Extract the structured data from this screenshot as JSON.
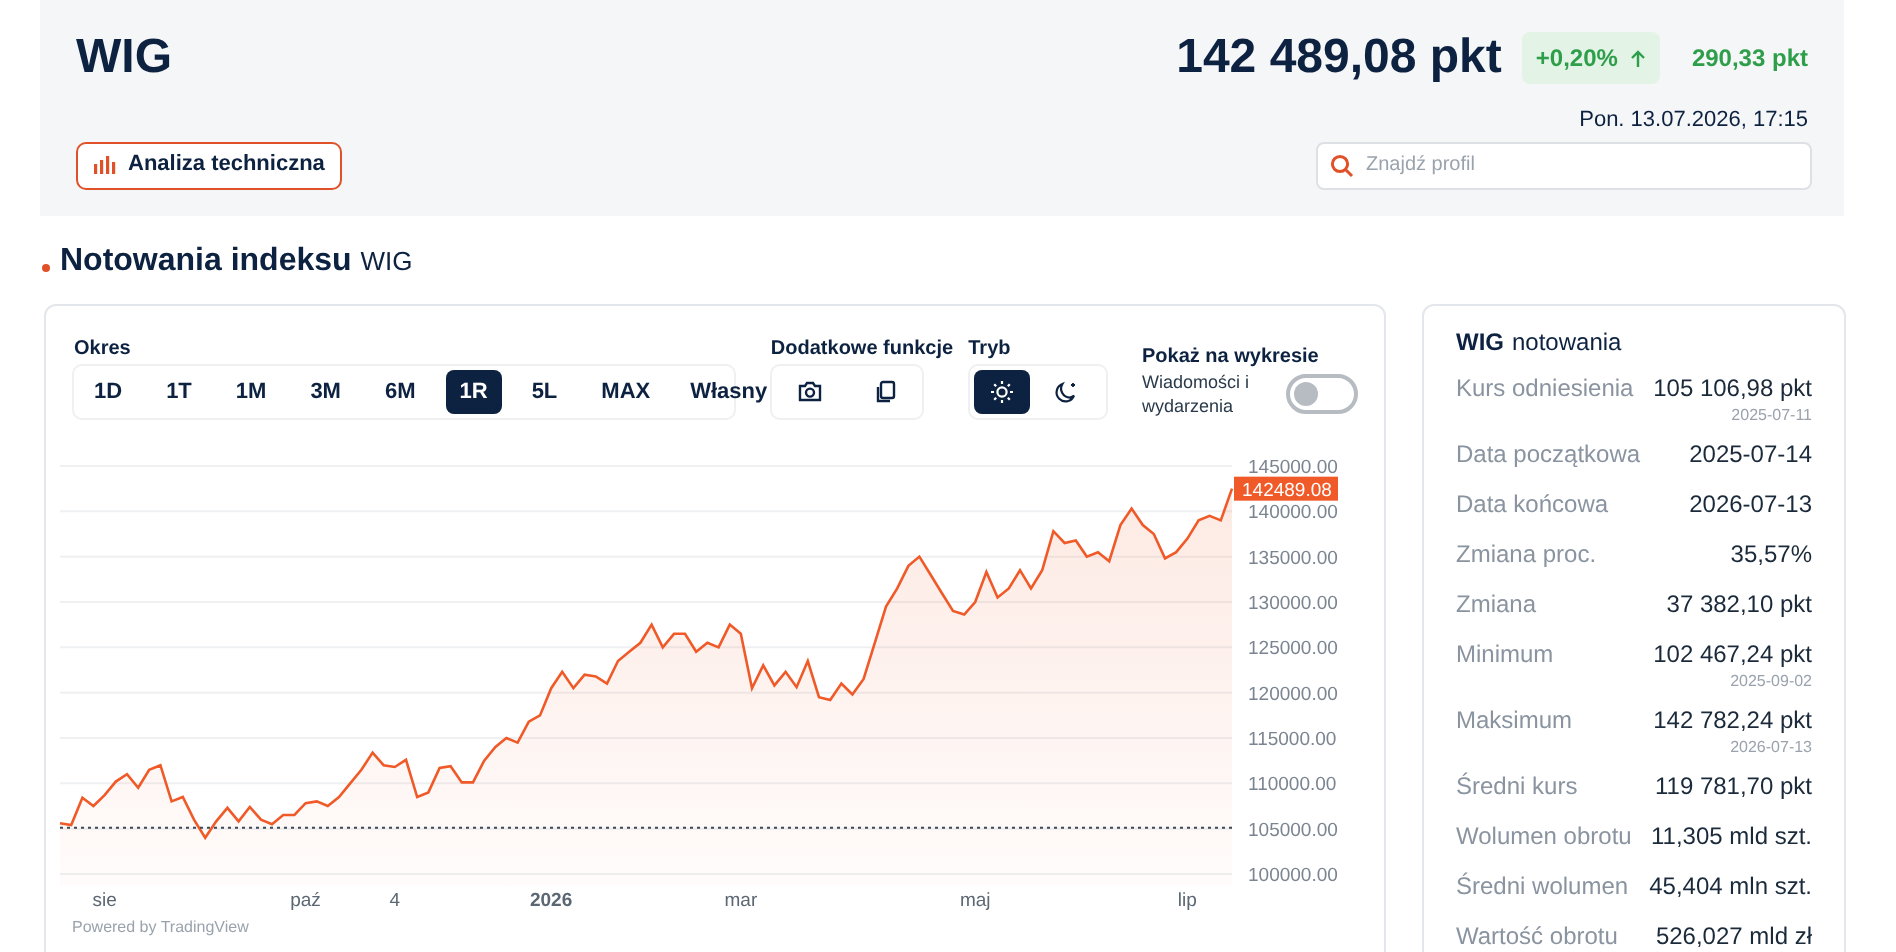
{
  "header": {
    "title": "WIG",
    "price": "142 489,08 pkt",
    "change_pct": "+0,20%",
    "change_abs": "290,33 pkt",
    "datetime": "Pon. 13.07.2026, 17:15",
    "tech_button": "Analiza techniczna",
    "search": {
      "placeholder": "Znajdź profil"
    }
  },
  "section": {
    "title": "Notowania indeksu",
    "suffix": "WIG"
  },
  "chart_panel": {
    "period_label": "Okres",
    "periods": [
      {
        "label": "1D",
        "selected": false
      },
      {
        "label": "1T",
        "selected": false
      },
      {
        "label": "1M",
        "selected": false
      },
      {
        "label": "3M",
        "selected": false
      },
      {
        "label": "6M",
        "selected": false
      },
      {
        "label": "1R",
        "selected": true
      },
      {
        "label": "5L",
        "selected": false
      },
      {
        "label": "MAX",
        "selected": false
      },
      {
        "label": "Własny",
        "selected": false
      }
    ],
    "extra_label": "Dodatkowe funkcje",
    "tools": [
      {
        "kind": "camera"
      },
      {
        "kind": "copy"
      }
    ],
    "mode_label": "Tryb",
    "modes": [
      {
        "kind": "light",
        "selected": true
      },
      {
        "kind": "dark",
        "selected": false
      }
    ],
    "show_label": "Pokaż na wykresie",
    "news_toggle": {
      "label": "Wiadomości i wydarzenia",
      "on": false
    },
    "chart_data": {
      "type": "area",
      "categories": [
        null,
        null,
        null,
        null,
        "sie",
        null,
        null,
        null,
        null,
        null,
        null,
        null,
        null,
        null,
        null,
        null,
        null,
        null,
        null,
        null,
        null,
        null,
        "paź",
        null,
        null,
        null,
        null,
        null,
        null,
        null,
        "4",
        null,
        null,
        null,
        null,
        null,
        null,
        null,
        null,
        null,
        null,
        null,
        null,
        null,
        "2026",
        null,
        null,
        null,
        null,
        null,
        null,
        null,
        null,
        null,
        null,
        null,
        null,
        null,
        null,
        null,
        null,
        "mar",
        null,
        null,
        null,
        null,
        null,
        null,
        null,
        null,
        null,
        null,
        null,
        null,
        null,
        null,
        null,
        null,
        null,
        null,
        null,
        null,
        "maj",
        null,
        null,
        null,
        null,
        null,
        null,
        null,
        null,
        null,
        null,
        null,
        null,
        null,
        null,
        null,
        null,
        null,
        null,
        "lip",
        null,
        null,
        null,
        null
      ],
      "series": [
        {
          "color": "#f05a28",
          "values": [
            105600,
            105400,
            108400,
            107500,
            108700,
            110200,
            111000,
            109500,
            111500,
            112000,
            108000,
            108500,
            106000,
            104000,
            105800,
            107300,
            105800,
            107400,
            106000,
            105500,
            106500,
            106500,
            107800,
            108000,
            107500,
            108500,
            110000,
            111500,
            113400,
            112000,
            111800,
            112600,
            108500,
            109000,
            111700,
            111900,
            110100,
            110100,
            112500,
            114000,
            115000,
            114500,
            116800,
            117500,
            120500,
            122300,
            120500,
            122000,
            121800,
            121000,
            123500,
            124500,
            125500,
            127500,
            125000,
            126500,
            126500,
            124500,
            125500,
            125000,
            127500,
            126500,
            120500,
            123000,
            120800,
            122300,
            120600,
            123500,
            119500,
            119200,
            121000,
            119800,
            121500,
            125500,
            129500,
            131500,
            134000,
            135000,
            133000,
            131000,
            129000,
            128600,
            130000,
            133300,
            130500,
            131500,
            133500,
            131500,
            133500,
            137800,
            136500,
            136800,
            135000,
            135500,
            134500,
            138500,
            140300,
            138500,
            137500,
            134800,
            135500,
            137000,
            139000,
            139500,
            139000,
            142500
          ]
        }
      ],
      "grid": true,
      "ylim": [
        100000,
        145000
      ],
      "yticks": [
        {
          "value": 100000,
          "label": "100000.00"
        },
        {
          "value": 105000,
          "label": "105000.00"
        },
        {
          "value": 110000,
          "label": "110000.00"
        },
        {
          "value": 115000,
          "label": "115000.00"
        },
        {
          "value": 120000,
          "label": "120000.00"
        },
        {
          "value": 125000,
          "label": "125000.00"
        },
        {
          "value": 130000,
          "label": "130000.00"
        },
        {
          "value": 135000,
          "label": "135000.00"
        },
        {
          "value": 140000,
          "label": "140000.00"
        },
        {
          "value": 145000,
          "label": "145000.00"
        }
      ],
      "ref_lines": [
        {
          "axis": "y",
          "value": 105107
        }
      ],
      "annotations": [
        "142489.08"
      ]
    },
    "footer": "Powered by TradingView"
  },
  "stats": {
    "title_bold": "WIG",
    "title_rest": "notowania",
    "rows": [
      {
        "label": "Kurs odniesienia",
        "value": "105 106,98 pkt",
        "date": "2025-07-11"
      },
      {
        "label": "Data początkowa",
        "value": "2025-07-14"
      },
      {
        "label": "Data końcowa",
        "value": "2026-07-13"
      },
      {
        "label": "Zmiana proc.",
        "value": "35,57%"
      },
      {
        "label": "Zmiana",
        "value": "37 382,10 pkt"
      },
      {
        "label": "Minimum",
        "value": "102 467,24 pkt",
        "date": "2025-09-02"
      },
      {
        "label": "Maksimum",
        "value": "142 782,24 pkt",
        "date": "2026-07-13"
      },
      {
        "label": "Średni kurs",
        "value": "119 781,70 pkt"
      },
      {
        "label": "Wolumen obrotu",
        "value": "11,305 mld szt."
      },
      {
        "label": "Średni wolumen",
        "value": "45,404 mln szt."
      },
      {
        "label": "Wartość obrotu",
        "value": "526,027 mld zł"
      }
    ]
  }
}
